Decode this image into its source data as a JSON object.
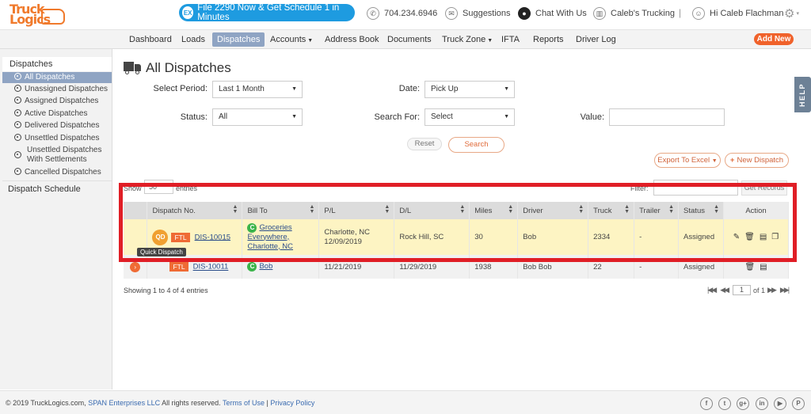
{
  "header": {
    "logo_line1": "Truck",
    "logo_line2": "Logics",
    "promo_icon": "EX",
    "promo_text": "File 2290 Now & Get Schedule 1 in Minutes",
    "phone_icon": "phone-icon",
    "phone": "704.234.6946",
    "suggestions_icon": "mail-icon",
    "suggestions": "Suggestions",
    "chat_icon": "chat-bubble-icon",
    "chat": "Chat With Us",
    "company_icon": "building-icon",
    "company": "Caleb's Trucking",
    "separator": "|",
    "user_icon": "user-icon",
    "greeting": "Hi Caleb Flachman",
    "settings_icon": "gear-icon"
  },
  "menu": {
    "items": [
      {
        "label": "Dashboard"
      },
      {
        "label": "Loads"
      },
      {
        "label": "Dispatches",
        "active": true
      },
      {
        "label": "Accounts",
        "dropdown": true
      },
      {
        "label": "Address Book"
      },
      {
        "label": "Documents"
      },
      {
        "label": "Truck Zone",
        "dropdown": true
      },
      {
        "label": "IFTA"
      },
      {
        "label": "Reports"
      },
      {
        "label": "Driver Log"
      }
    ],
    "add_new": "Add New"
  },
  "sidebar": {
    "section": "Dispatches",
    "items": [
      {
        "label": "All Dispatches",
        "active": true
      },
      {
        "label": "Unassigned Dispatches"
      },
      {
        "label": "Assigned Dispatches"
      },
      {
        "label": "Active Dispatches"
      },
      {
        "label": "Delivered Dispatches"
      },
      {
        "label": "Unsettled Dispatches"
      },
      {
        "label": "Unsettled Dispatches With Settlements"
      },
      {
        "label": "Cancelled Dispatches"
      }
    ],
    "schedule": "Dispatch Schedule"
  },
  "page": {
    "title": "All Dispatches",
    "help": "HELP"
  },
  "filters": {
    "period_label": "Select Period:",
    "period_value": "Last 1 Month",
    "date_label": "Date:",
    "date_value": "Pick Up",
    "status_label": "Status:",
    "status_value": "All",
    "search_for_label": "Search For:",
    "search_for_value": "Select",
    "value_label": "Value:",
    "value_value": "",
    "reset": "Reset",
    "search": "Search"
  },
  "actions": {
    "export": "Export To Excel",
    "new_dispatch": "New Dispatch"
  },
  "table_controls": {
    "show_label": "Show",
    "show_value": "50",
    "entries_label": "entries",
    "filter_label": "Filter:",
    "get_records": "Get Records"
  },
  "table": {
    "columns": [
      "Dispatch No.",
      "Bill To",
      "P/L",
      "D/L",
      "Miles",
      "Driver",
      "Truck",
      "Trailer",
      "Status",
      "Action"
    ],
    "rows": [
      {
        "badge_qd": "QD",
        "badge_type": "FTL",
        "dispatch_no": "DIS-10015",
        "customer_badge": "C",
        "bill_to": "Groceries Everywhere, Charlotte, NC",
        "pl_city": "Charlotte, NC",
        "pl_date": "12/09/2019",
        "dl_city": "Rock Hill, SC",
        "dl_date": "",
        "miles": "30",
        "driver": "Bob",
        "truck": "2334",
        "trailer": "-",
        "status": "Assigned",
        "tooltip": "Quick Dispatch"
      },
      {
        "badge_type": "FTL",
        "dispatch_no": "DIS-10011",
        "customer_badge": "C",
        "bill_to": "Bob",
        "pl_date": "11/21/2019",
        "dl_date": "11/29/2019",
        "miles": "1938",
        "driver": "Bob Bob",
        "truck": "22",
        "trailer": "-",
        "status": "Assigned"
      }
    ],
    "showing": "Showing 1 to 4 of 4 entries",
    "page_value": "1",
    "page_of": "of 1"
  },
  "footer": {
    "copyright": "© 2019 TruckLogics.com,",
    "company_link": "SPAN Enterprises LLC",
    "rights": "All rights reserved.",
    "terms": "Terms of Use",
    "divider": "|",
    "privacy": "Privacy Policy",
    "social": [
      "f",
      "t",
      "g+",
      "in",
      "▶",
      "P"
    ]
  },
  "colors": {
    "accent": "#ef6b35",
    "promo": "#1e9be0",
    "active_nav": "#8fa4c3",
    "highlight_row": "#fdf4c3",
    "annotation": "#e01e26"
  }
}
